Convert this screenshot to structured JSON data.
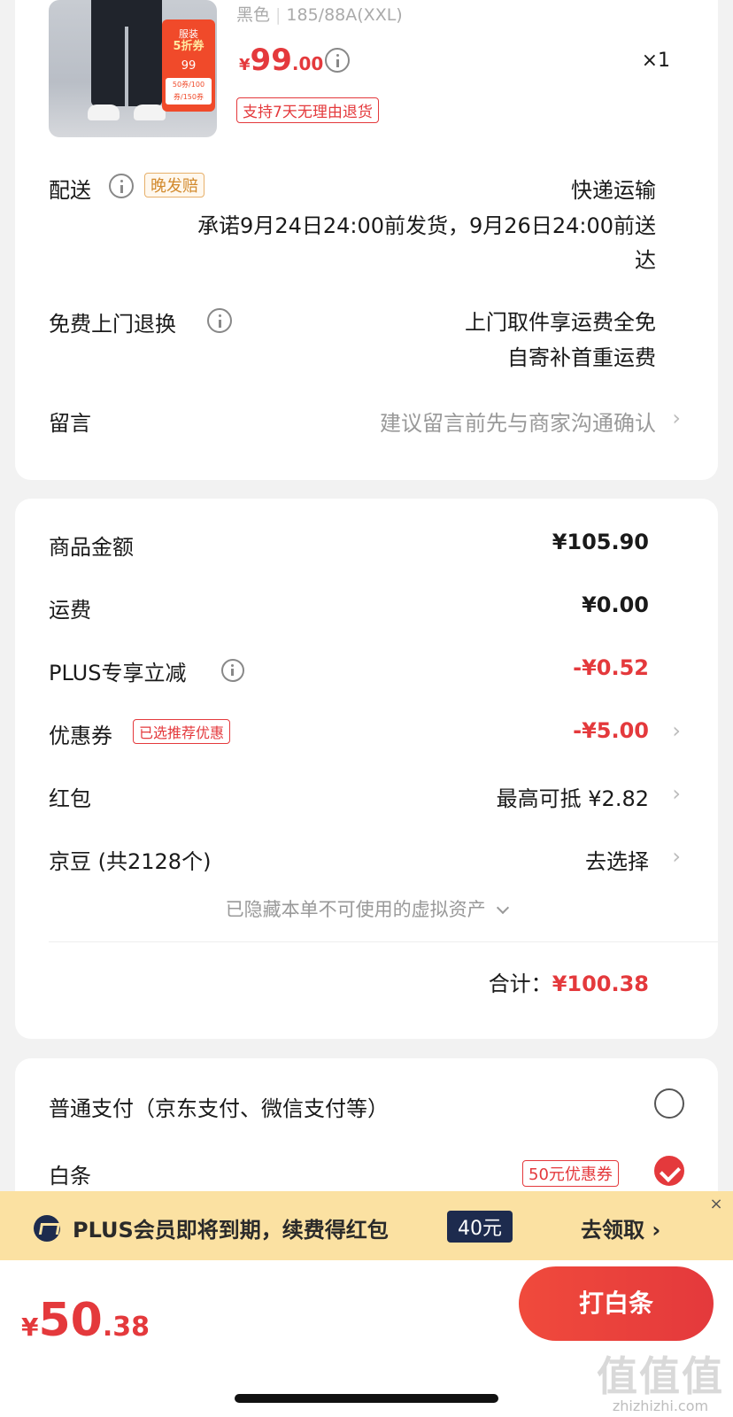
{
  "product": {
    "color": "黑色",
    "size": "185/88A(XXL)",
    "price_currency": "¥",
    "price_int": "99",
    "price_dec": ".00",
    "quantity": "×1",
    "return_tag": "支持7天无理由退货",
    "image_promo": {
      "line1": "服装",
      "line2": "5折券",
      "price": "99",
      "coupon": "50券/100券/150券"
    }
  },
  "delivery": {
    "label": "配送",
    "tag": "晚发赔",
    "method": "快递运输",
    "promise_line1": "承诺9月24日24:00前发货，9月26日24:00前送",
    "promise_line2": "达"
  },
  "free_return": {
    "label": "免费上门退换",
    "line1": "上门取件享运费全免",
    "line2": "自寄补首重运费"
  },
  "message": {
    "label": "留言",
    "placeholder": "建议留言前先与商家沟通确认"
  },
  "summary": {
    "goods_label": "商品金额",
    "goods_value": "¥105.90",
    "shipping_label": "运费",
    "shipping_value": "¥0.00",
    "plus_label": "PLUS专享立减",
    "plus_value": "-¥0.52",
    "coupon_label": "优惠券",
    "coupon_tag": "已选推荐优惠",
    "coupon_value": "-¥5.00",
    "redpacket_label": "红包",
    "redpacket_value": "最高可抵 ¥2.82",
    "jingdou_label": "京豆 (共2128个)",
    "jingdou_value": "去选择",
    "hidden_assets": "已隐藏本单不可使用的虚拟资产",
    "total_label": "合计：",
    "total_value": "¥100.38"
  },
  "payment": {
    "normal_label": "普通支付（京东支付、微信支付等）",
    "baitiao_label": "白条",
    "baitiao_tag": "50元优惠券"
  },
  "banner": {
    "text": "PLUS会员即将到期，续费得红包",
    "badge": "40元",
    "action": "去领取 ›",
    "close": "×"
  },
  "bottom": {
    "currency": "¥",
    "int": "50",
    "dec": ".38",
    "button": "打白条"
  },
  "watermark": {
    "logo": "值值值",
    "url": "zhizhizhi.com"
  },
  "colors": {
    "accent": "#e4393c",
    "banner_bg": "#fbe1a2",
    "plus_navy": "#1d2b4e"
  }
}
